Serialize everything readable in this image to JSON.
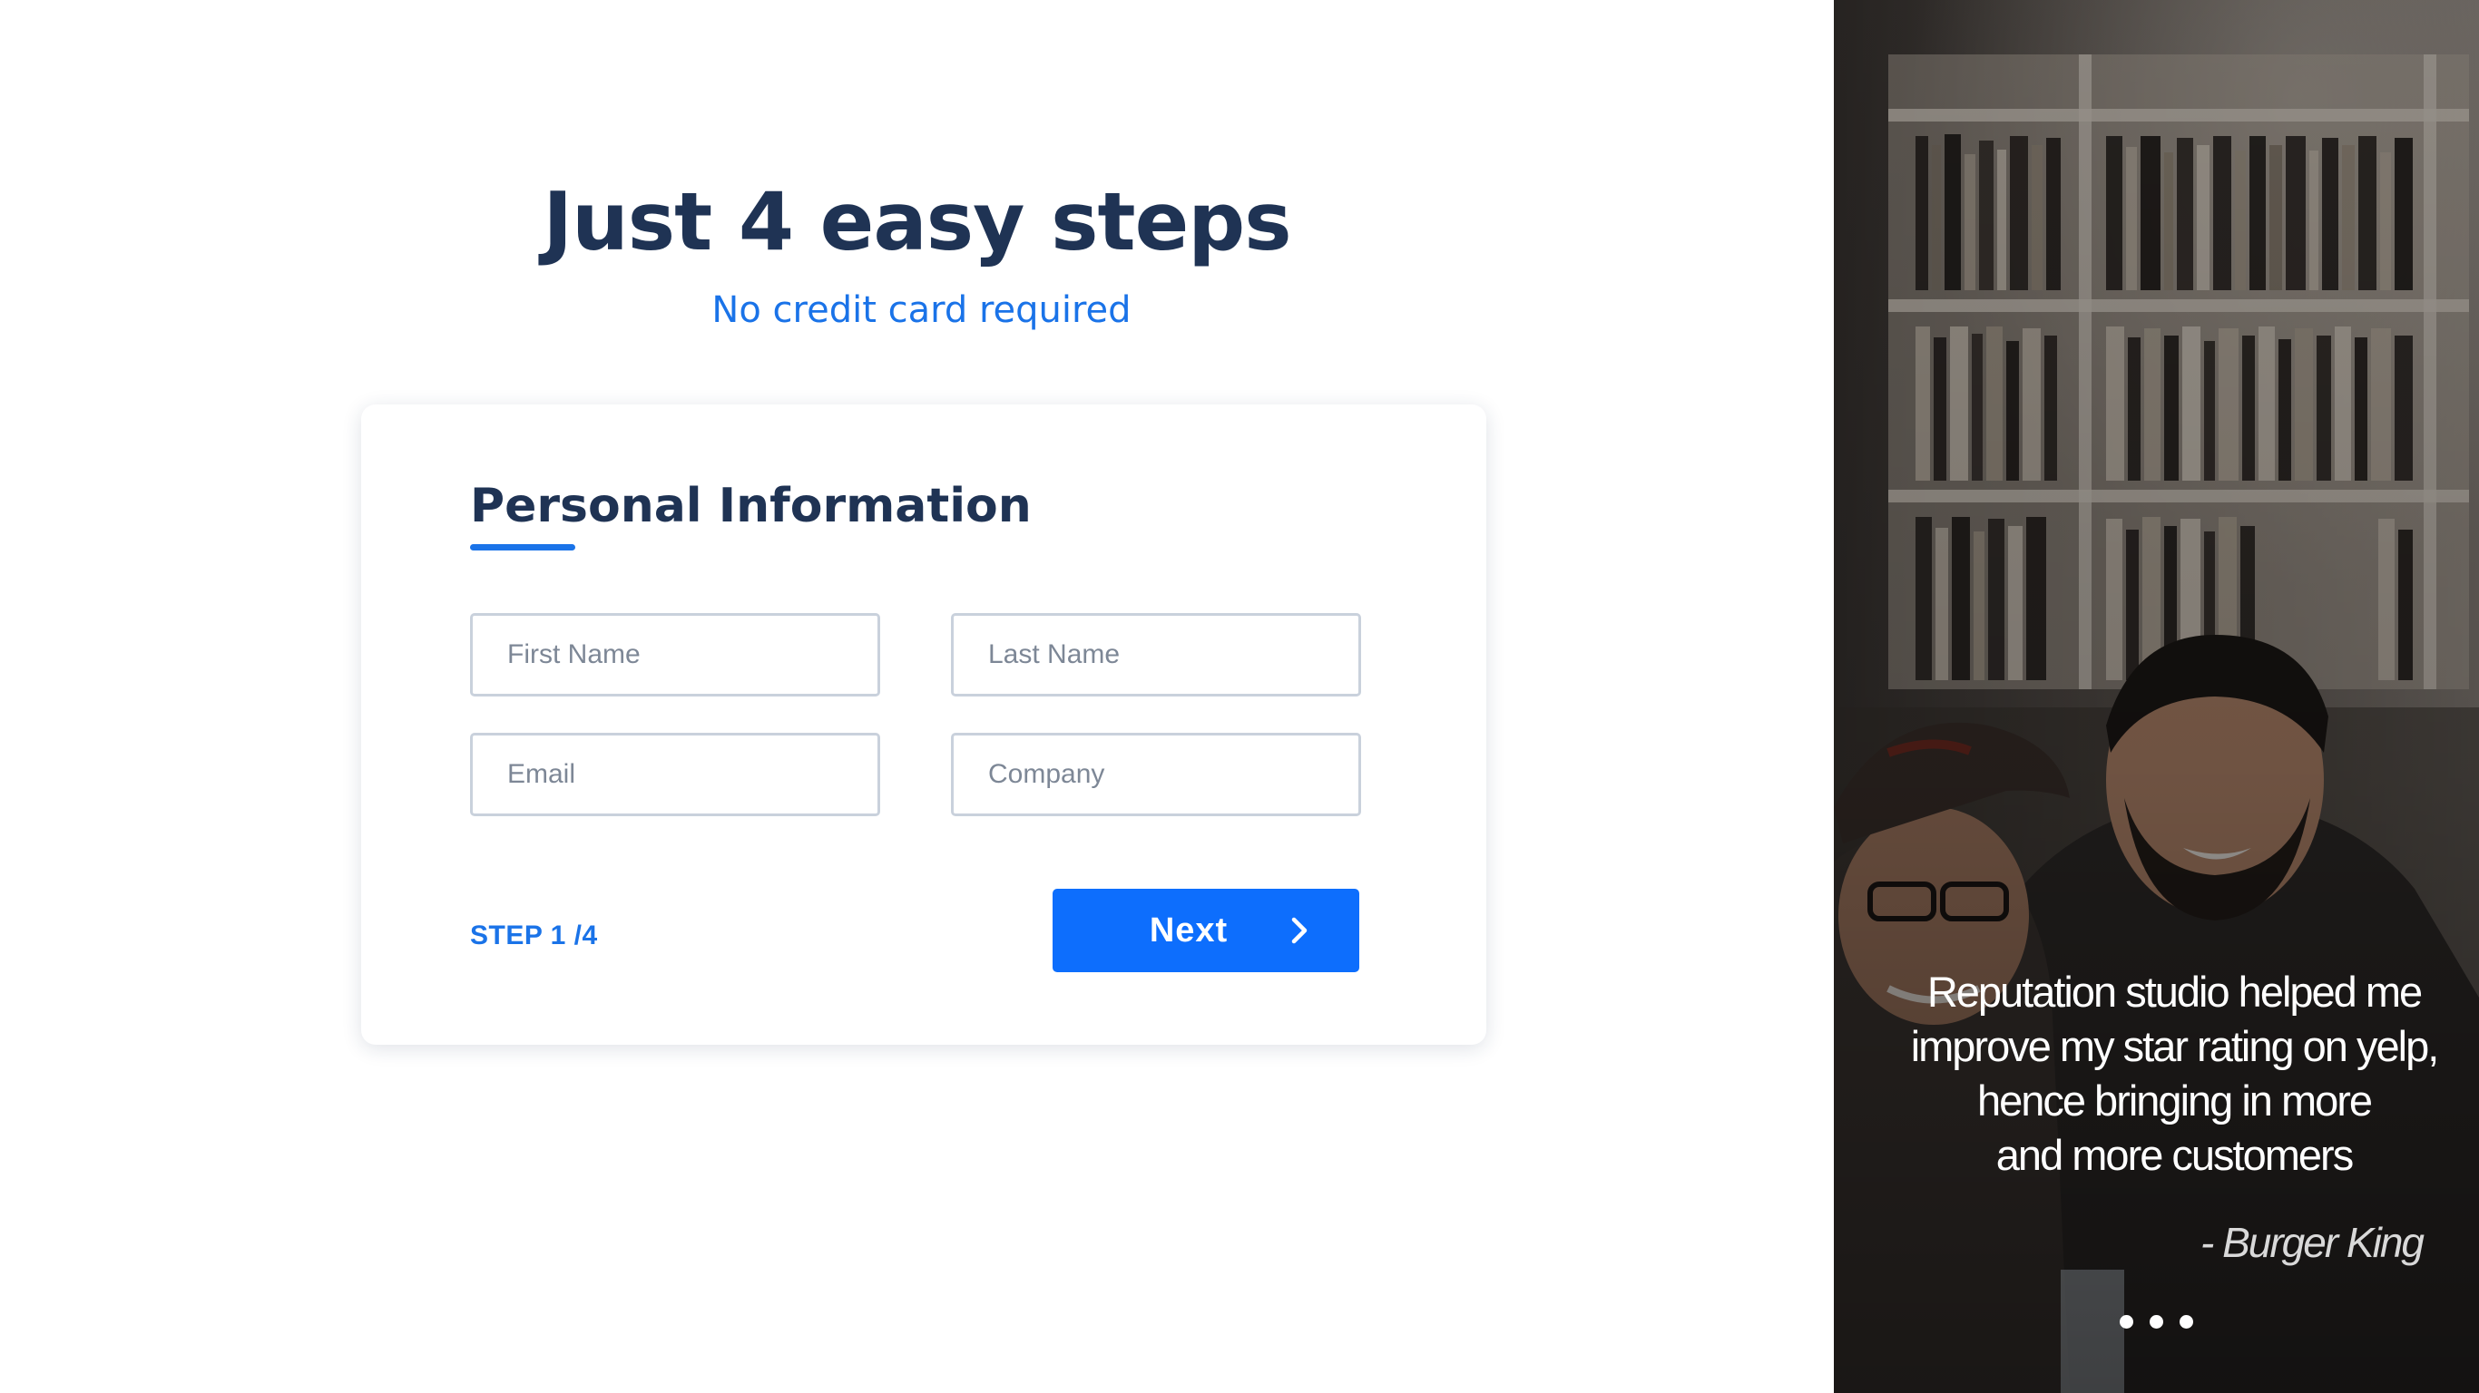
{
  "header": {
    "title": "Just 4 easy steps",
    "subtitle": "No credit card required"
  },
  "form": {
    "heading": "Personal Information",
    "fields": {
      "first_name": {
        "placeholder": "First Name",
        "value": ""
      },
      "last_name": {
        "placeholder": "Last Name",
        "value": ""
      },
      "email": {
        "placeholder": "Email",
        "value": ""
      },
      "company": {
        "placeholder": "Company",
        "value": ""
      }
    },
    "step_text": "STEP 1 /4",
    "next_label": "Next"
  },
  "testimonial": {
    "quote_lines": [
      "Reputation studio helped me",
      "improve my  star rating on yelp,",
      "hence bringing in  more",
      "and more customers"
    ],
    "attribution": "- Burger King",
    "carousel_dot_count": 3
  },
  "icons": {
    "next": "chevron-right-icon"
  },
  "colors": {
    "title": "#1f3354",
    "accent": "#1a73e8",
    "button": "#0d6efd",
    "field_border": "#c9d1dc",
    "placeholder": "#7d8796"
  }
}
